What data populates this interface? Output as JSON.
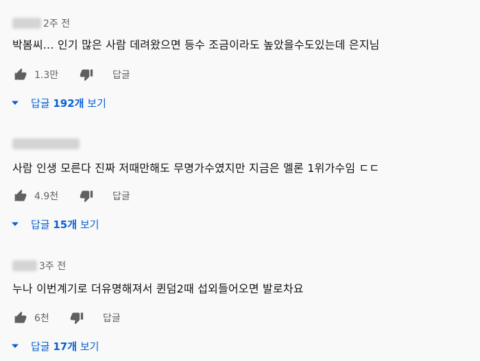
{
  "colors": {
    "background": "#f9f9f9",
    "link": "#065fd4",
    "meta": "#606060",
    "icon": "#606060"
  },
  "icons": {
    "like": "thumbs-up-icon",
    "dislike": "thumbs-down-icon",
    "expand": "caret-down-icon"
  },
  "comments": [
    {
      "timestamp": "2주 전",
      "text": "박봄씨... 인기 많은 사람 데려왔으면 등수 조금이라도 높았을수도있는데 은지님",
      "likes": "1.3만",
      "reply_label": "답글",
      "replies_prefix": "답글 ",
      "replies_count": "192개",
      "replies_suffix": " 보기"
    },
    {
      "timestamp": "",
      "text": "사람 인생 모른다 진짜 저때만해도 무명가수였지만 지금은 멜론 1위가수임 ㄷㄷ",
      "likes": "4.9천",
      "reply_label": "답글",
      "replies_prefix": "답글 ",
      "replies_count": "15개",
      "replies_suffix": " 보기"
    },
    {
      "timestamp": "3주 전",
      "text": "누나 이번계기로 더유명해져서 퀸덤2때 섭외들어오면 발로차요",
      "likes": "6천",
      "reply_label": "답글",
      "replies_prefix": "답글 ",
      "replies_count": "17개",
      "replies_suffix": " 보기"
    }
  ]
}
